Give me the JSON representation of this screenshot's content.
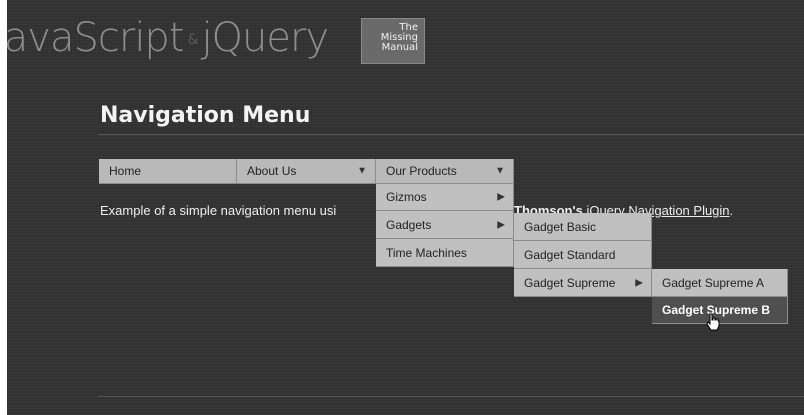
{
  "header": {
    "logo_main": "JavaScript",
    "logo_amp": "&",
    "logo_second": "jQuery",
    "book_badge_lines": [
      "The",
      "Missing",
      "Manual"
    ]
  },
  "page": {
    "title": "Navigation Menu",
    "description_prefix": "Example of a simple navigation menu usi",
    "description_author_fragment": "Thomson's",
    "description_link": "jQuery Navigation Plugin",
    "description_end": "."
  },
  "nav": {
    "top": [
      {
        "label": "Home",
        "has_arrow": false
      },
      {
        "label": "About Us",
        "has_arrow": true,
        "arrow": "▼"
      },
      {
        "label": "Our Products",
        "has_arrow": true,
        "arrow": "▼"
      }
    ],
    "products_menu": [
      {
        "label": "Gizmos",
        "arrow": "▶"
      },
      {
        "label": "Gadgets",
        "arrow": "▶"
      },
      {
        "label": "Time Machines",
        "arrow": ""
      }
    ],
    "gadgets_menu": [
      {
        "label": "Gadget Basic",
        "arrow": ""
      },
      {
        "label": "Gadget Standard",
        "arrow": ""
      },
      {
        "label": "Gadget Supreme",
        "arrow": "▶"
      }
    ],
    "supreme_menu": [
      {
        "label": "Gadget Supreme A"
      },
      {
        "label": "Gadget Supreme B"
      }
    ]
  },
  "colors": {
    "background": "#333333",
    "menu_item": "#b9b9b9",
    "menu_hover": "#4f4f4f",
    "text_light": "#f4f4f4"
  },
  "icons": {
    "cursor": "hand-pointer-icon"
  }
}
